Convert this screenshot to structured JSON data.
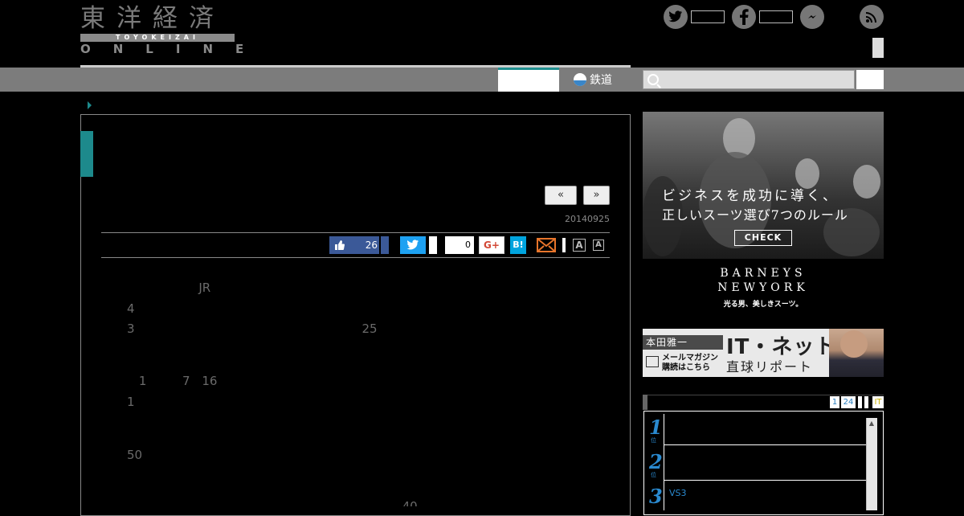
{
  "logo": {
    "main": "東洋経済",
    "sub": "TOYOKEIZAI",
    "online": "ONLINE"
  },
  "header": {
    "social": [
      "twitter-icon",
      "facebook-icon",
      "messenger-icon",
      "rss-icon"
    ],
    "nav_item_tetsudo": "鉄道",
    "search_placeholder": ""
  },
  "article": {
    "prev_label": "«",
    "next_label": "»",
    "date": "20140925",
    "share": {
      "like_count": "26",
      "tweet_count": "0",
      "gplus_label": "G+",
      "hatena_label": "B!",
      "font_small": "A",
      "font_large": "A"
    },
    "paragraphs": [
      "　　　　　　JR　　　　　　　　　　　　　　　　　　　　　　　　　　　　　　　　　4　　　　　　　　　　　　　　　　　　　　　　　　　　　　　　　　　　　　　　　　　3　　　　　　　　　　　　　　　　　　　25　　　　　　　　　　　　　　　　　　　　　　　　　　　　　　　　　　　　　　　　　　　　",
      "　1　　　7　16　　　　　　　　　　　　　　　　　　　　　　　　　　　　　　　　　　　　　　　　　　　　　　　　1　　　　　　　　　　　　　　　　　　　",
      "　　　　　　　　　　　　　　　　　　　　　　　　　　　　　　　　　　　　　　　　　　　　　　　　　　　　　　　50　　　　　　　　　　　　　　　　　　　　　　　　　　",
      "　　　　　　　　　　　　　　　　　　　　　　　40　　　　　　　　　　　　　　77　　　　　　　　　　　　　"
    ]
  },
  "ads": {
    "suits": {
      "copy_line1": "ビジネスを成功に導く、",
      "copy_line2": "正しいスーツ選び7つのルール",
      "cta": "CHECK",
      "brand_line1": "BARNEYS",
      "brand_line2": "NEWYORK",
      "tagline": "光る男、美しきスーツ。"
    },
    "newsletter": {
      "author": "本田雅一",
      "title": "IT・ネット",
      "subtitle": "直球リポート",
      "mm_line1": "メールマガジン",
      "mm_line2": "購読はこちら"
    }
  },
  "ranking": {
    "tabs": [
      "1",
      "24",
      "",
      "",
      "IT"
    ],
    "items": [
      {
        "num": "1",
        "sub": "位",
        "text": ""
      },
      {
        "num": "2",
        "sub": "位",
        "text": ""
      },
      {
        "num": "3",
        "sub": "",
        "text": "VS3"
      }
    ]
  }
}
